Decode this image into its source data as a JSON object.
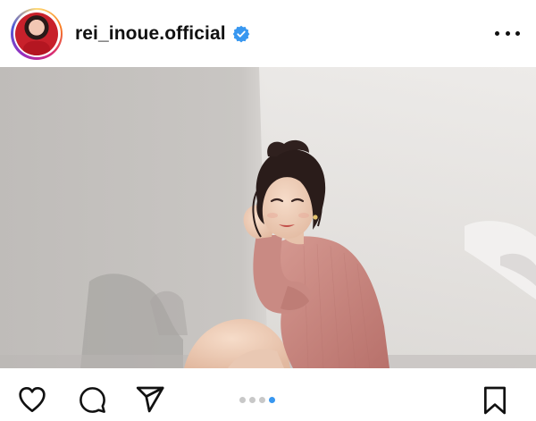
{
  "header": {
    "username": "rei_inoue.official",
    "verified": true,
    "avatar_icon": "profile-avatar",
    "more_icon": "more-options-icon"
  },
  "photo": {
    "description_icon": "post-photo"
  },
  "actions": {
    "like_icon": "heart-icon",
    "comment_icon": "comment-icon",
    "share_icon": "send-icon",
    "save_icon": "bookmark-icon",
    "carousel": {
      "total": 4,
      "current": 4
    }
  },
  "colors": {
    "verified": "#3897f0",
    "active_dot": "#3897f0",
    "inactive_dot": "#c8c8c8",
    "sweater": "#c8817a"
  }
}
